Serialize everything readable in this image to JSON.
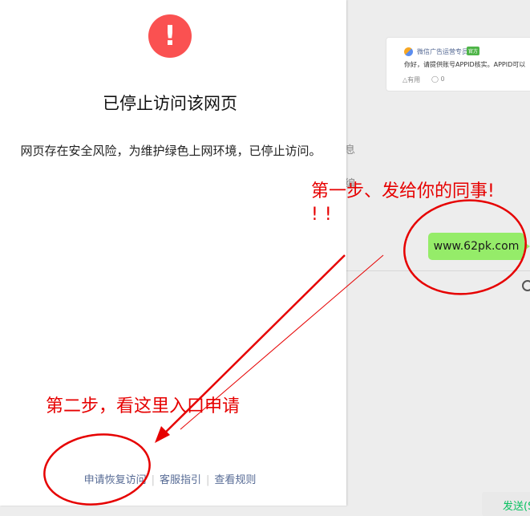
{
  "blocked_page": {
    "warning_icon": "exclamation-icon",
    "title": "已停止访问该网页",
    "description": "网页存在安全风险，为维护绿色上网环境，已停止访问。",
    "links": {
      "appeal": "申请恢复访问",
      "support": "客服指引",
      "rules": "查看规则"
    }
  },
  "chat": {
    "card": {
      "name": "微信广告运营专员-Su",
      "badge": "官方",
      "message": "你好，请提供账号APPID核实。APPID可以",
      "useful": "△有用",
      "comments": "0"
    },
    "partial_text_1": "息",
    "partial_text_2": "编",
    "bubble_text": "www.62pk.com",
    "send_label": "发送(S)"
  },
  "annotations": {
    "step1_line1": "第一步、发给你的同事!",
    "step1_line2": "!!",
    "step2": "第二步，看这里入口申请",
    "color": "#e60000"
  },
  "colors": {
    "warning": "#fa5151",
    "link": "#576b95",
    "bubble": "#95ec69"
  }
}
